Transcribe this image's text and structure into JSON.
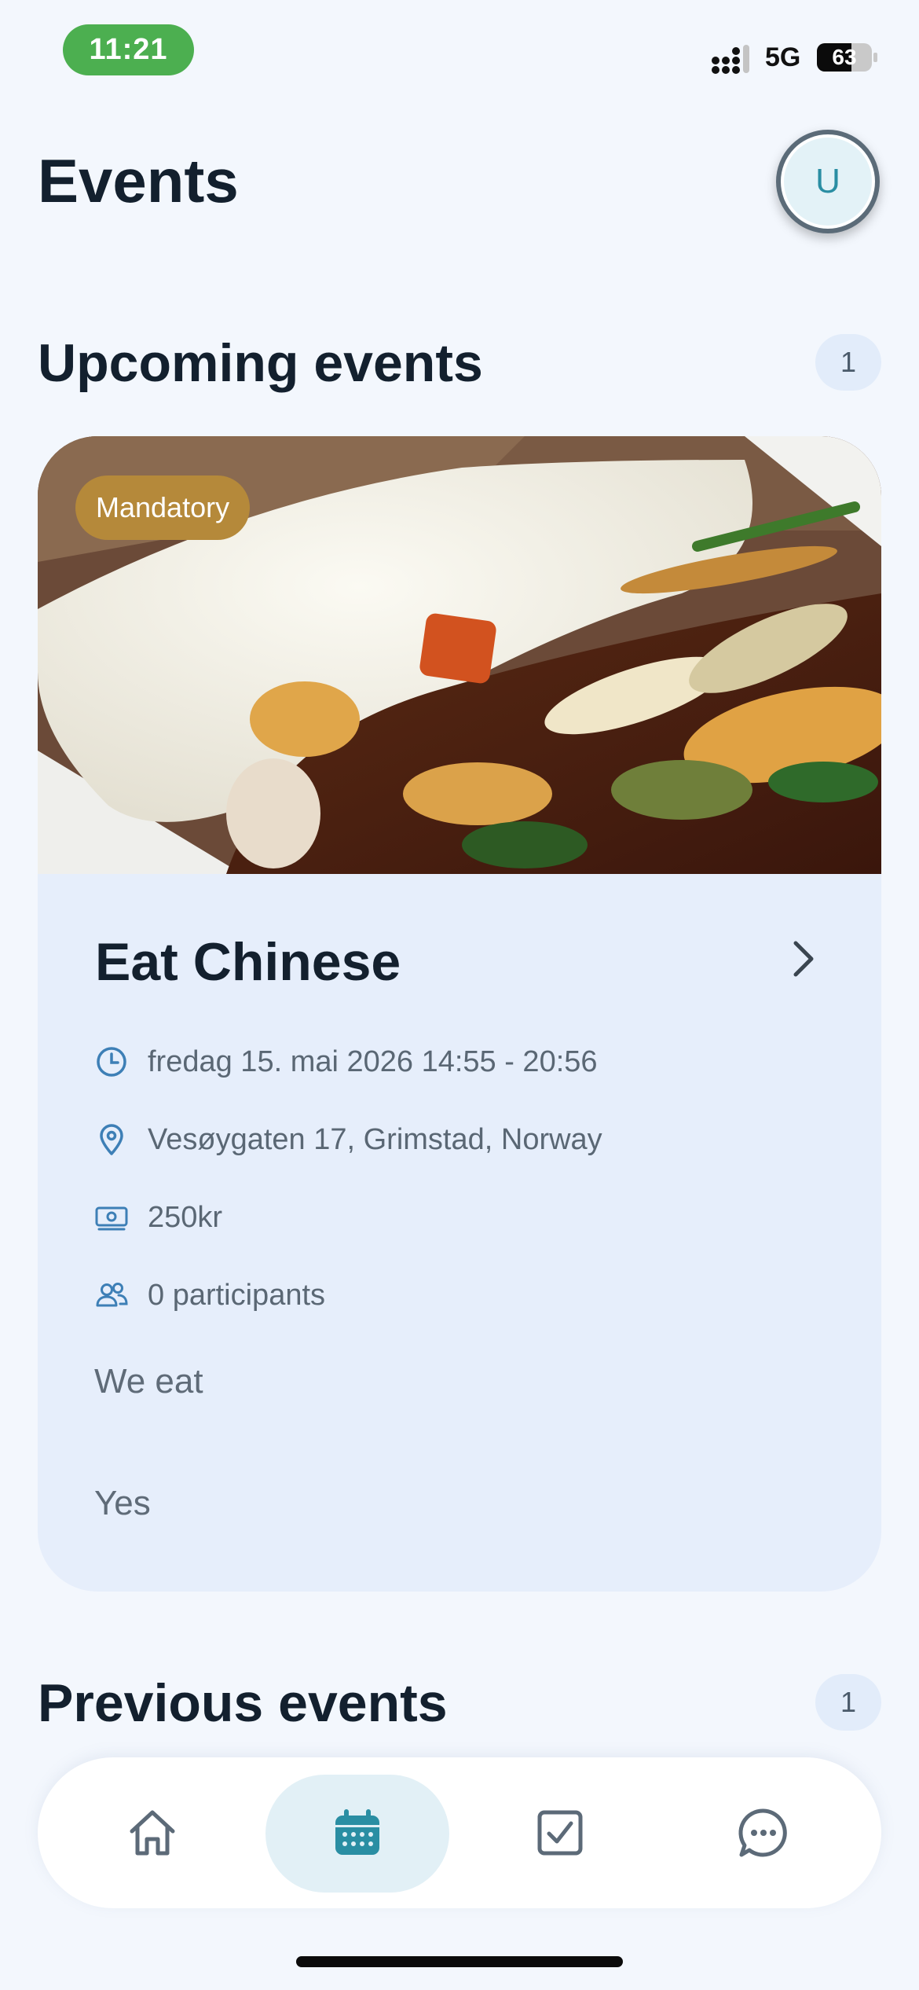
{
  "status_bar": {
    "time": "11:21",
    "network": "5G",
    "battery_level": 63,
    "battery_text": "63"
  },
  "header": {
    "title": "Events",
    "avatar_initial": "U"
  },
  "upcoming": {
    "title": "Upcoming events",
    "count": "1",
    "event": {
      "tag": "Mandatory",
      "title": "Eat Chinese",
      "datetime": "fredag 15. mai 2026 14:55 - 20:56",
      "location": "Vesøygaten 17, Grimstad, Norway",
      "price": "250kr",
      "participants": "0 participants",
      "description_line1": "We eat",
      "description_line2": "Yes",
      "icons": [
        "clock-icon",
        "location-pin-icon",
        "money-icon",
        "people-icon",
        "chevron-right-icon"
      ]
    }
  },
  "previous": {
    "title": "Previous events",
    "count": "1"
  },
  "bottom_nav": {
    "items": [
      "home-icon",
      "calendar-icon",
      "checkbox-icon",
      "chat-icon"
    ],
    "active": "calendar-icon"
  },
  "colors": {
    "accent": "#2a8ea3",
    "tag_bg": "#b5893a",
    "card_bg": "#e6eefb",
    "page_bg": "#f3f7fd"
  }
}
